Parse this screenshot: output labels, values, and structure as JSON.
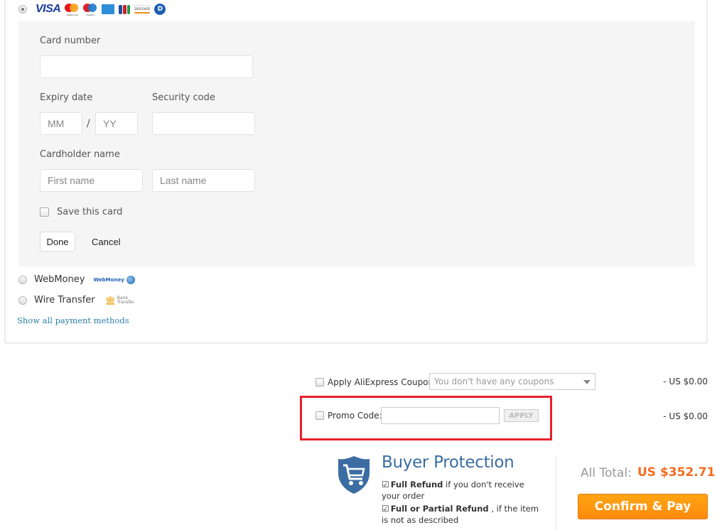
{
  "payment_methods": {
    "card": {
      "selected": true,
      "logos": [
        "visa",
        "mastercard",
        "maestro",
        "amex",
        "jcb",
        "discover",
        "diners"
      ],
      "visa_text": "VISA",
      "mastercard_text": "mastercard",
      "maestro_text": "maestro",
      "discover_text": "DISCOVER",
      "diners_text": "D",
      "form": {
        "card_number_label": "Card number",
        "card_number_value": "",
        "expiry_label": "Expiry date",
        "expiry_month_placeholder": "MM",
        "expiry_separator": "/",
        "expiry_year_placeholder": "YY",
        "security_code_label": "Security code",
        "security_code_value": "",
        "cardholder_label": "Cardholder name",
        "first_name_placeholder": "First name",
        "last_name_placeholder": "Last name",
        "save_card_label": "Save this card",
        "save_card_checked": false,
        "done_label": "Done",
        "cancel_label": "Cancel"
      }
    },
    "webmoney": {
      "label": "WebMoney",
      "logo_text": "WebMoney",
      "selected": false
    },
    "wire_transfer": {
      "label": "Wire Transfer",
      "logo_text_1": "Bank",
      "logo_text_2": "Transfer",
      "selected": false
    },
    "show_all_label": "Show all payment methods"
  },
  "summary": {
    "coupon": {
      "label": "Apply AliExpress Coupon:",
      "select_value": "You don't have any coupons",
      "amount": "- US $0.00",
      "checked": false
    },
    "promo": {
      "label": "Promo Code:",
      "value": "",
      "apply_label": "APPLY",
      "amount": "- US $0.00",
      "checked": false
    }
  },
  "buyer_protection": {
    "title": "Buyer Protection",
    "items": [
      {
        "bold": "Full Refund",
        "text": " if you don't receive your order"
      },
      {
        "bold": "Full or Partial Refund",
        "text": " , if the item is not as described"
      }
    ]
  },
  "total": {
    "label": "All Total:",
    "value": "US $352.71",
    "confirm_label": "Confirm & Pay"
  },
  "colors": {
    "accent_orange": "#ff8a0c",
    "total_orange": "#f56b1e",
    "link_blue": "#2a7fa8",
    "protection_blue": "#3b6da3",
    "highlight_red": "#e8202a"
  }
}
